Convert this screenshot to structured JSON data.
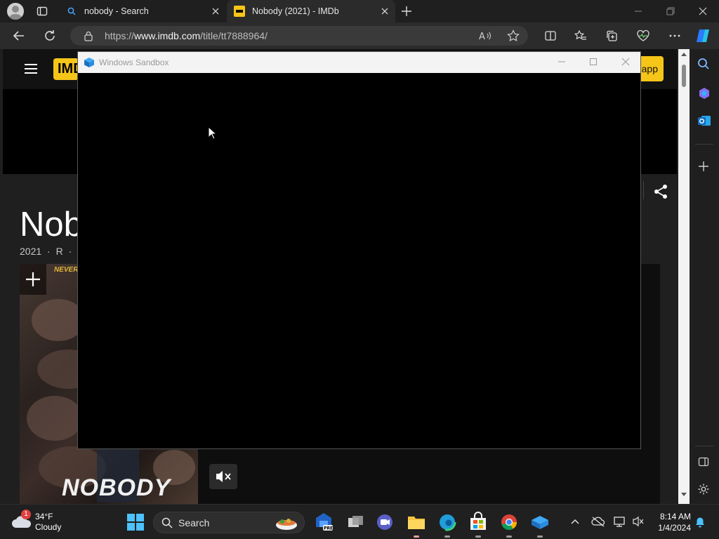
{
  "browser": {
    "tabs": [
      {
        "title": "nobody - Search"
      },
      {
        "title": "Nobody (2021) - IMDb"
      }
    ],
    "url_prefix": "https://",
    "url_domain": "www.imdb.com",
    "url_path": "/title/tt7888964/"
  },
  "imdb": {
    "logo_text": "IMDb",
    "app_button": "app",
    "movie_title": "Nob",
    "meta_year": "2021",
    "meta_rating": "R",
    "meta_sep": "·",
    "poster_tagline": "NEVER",
    "poster_title": "NOBODY"
  },
  "sandbox": {
    "title": "Windows Sandbox"
  },
  "taskbar": {
    "weather_temp": "34°F",
    "weather_cond": "Cloudy",
    "weather_badge": "1",
    "search_label": "Search",
    "time": "8:14 AM",
    "date": "1/4/2024"
  }
}
